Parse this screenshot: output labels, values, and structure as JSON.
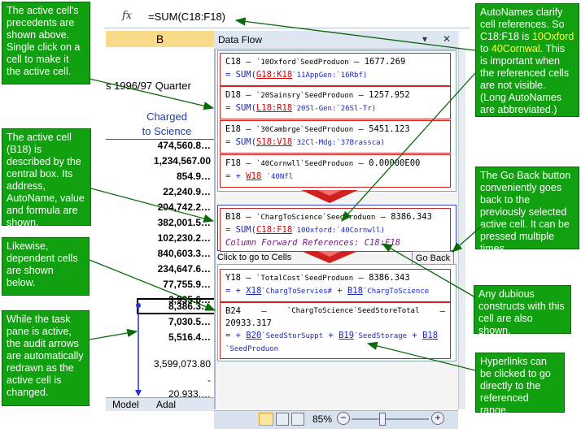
{
  "formula_bar": {
    "fx_label": "fx",
    "formula": "=SUM(C18:F18)"
  },
  "sheet": {
    "column_header": "B",
    "quarter_text": "s 1996/97 Quarter",
    "charged_line1": "Charged",
    "charged_line2": "to Science",
    "values": [
      "474,560.8…",
      "1,234,567.00",
      "854.9…",
      "22,240.9…",
      "204,742.2…",
      "382,001.5…",
      "102,230.2…",
      "840,603.3…",
      "234,647.6…",
      "77,755.9…",
      "3,935.6…",
      "8,386.3…",
      "7,030.5…",
      "5,516.4…",
      "3,599,073.80",
      "-",
      "20,933.…"
    ],
    "tabs": [
      "Model",
      "Adal"
    ]
  },
  "pane": {
    "title": "Data Flow",
    "click_label": "Click to go to Cells",
    "go_back": "Go Back",
    "precedents": [
      {
        "line1_cell": "C18",
        "line1_name": "`10Oxford`SeedProduon",
        "line1_val": "1677.269",
        "ref": "G18:K18",
        "ref_name": "`11AppGen:`16Rbf)"
      },
      {
        "line1_cell": "D18",
        "line1_name": "`20Sainsry`SeedProduon",
        "line1_val": "1257.952",
        "ref": "L18:R18",
        "ref_name": "`20Sl-Gen:`26Sl-Tr)"
      },
      {
        "line1_cell": "E18",
        "line1_name": "`30Cambrge`SeedProduon",
        "line1_val": "5451.123",
        "ref": "S18:V18",
        "ref_name": "`32Cl-Mdg:`37Brassca)"
      },
      {
        "line1_cell": "F18",
        "line1_name": "`40Cornwll`SeedProduon",
        "line1_val": "0.00000E00",
        "ref": "W18",
        "ref_name": "`40Nfl"
      }
    ],
    "active": {
      "cell": "B18",
      "name": "`ChargToScience`SeedProduon",
      "value": "8386.343",
      "ref": "C18:F18",
      "ref_name": "`10Oxford:`40Cornwll)",
      "forward": "Column Forward References: C18:F18"
    },
    "dependents": [
      {
        "cell": "Y18",
        "name": "`TotalCost`SeedProduon",
        "value": "8386.343",
        "ref1": "X18",
        "ref1_name": "`ChargToServies#",
        "ref2": "B18",
        "ref2_name": "`ChargToScience"
      },
      {
        "cell": "B24",
        "name": "`ChargToScience`SeedStoreTotal",
        "value": "20933.317",
        "ref1": "B20",
        "ref1_name": "`SeedStorSuppt",
        "ref2": "B19",
        "ref2_name": "`SeedStorage",
        "ref3": "B18",
        "ref3_name": "`SeedProduon"
      }
    ]
  },
  "status": {
    "zoom": "85%"
  },
  "callouts": {
    "c1": "The active cell's precedents are shown above. Single click on a cell to make it the active cell.",
    "c2": "The active cell (B18) is described by the central box. Its address, AutoName, value and formula are shown.",
    "c3": "Likewise, dependent cells are shown below.",
    "c4": "While the task pane is active, the audit arrows are automatically redrawn as the active cell is changed.",
    "c5a": "AutoNames clarify cell references.  So C18:F18 is ",
    "c5b": "10Oxford",
    "c5c": " to ",
    "c5d": "40Cornwal",
    "c5e": ".  This is important when the referenced cells are not visible.  (Long AutoNames are abbreviated.)",
    "c6": "The Go Back button conveniently goes back to the previously selected active cell.  It can be pressed multiple times.",
    "c7": "Any dubious constructs with this cell are also shown.",
    "c8": "Hyperlinks can be clicked to go directly to the referenced range."
  },
  "colors": {
    "callout": "#10a010",
    "box_border": "#d02020",
    "arrow": "#d02020",
    "pointer": "#0a6a0a"
  }
}
